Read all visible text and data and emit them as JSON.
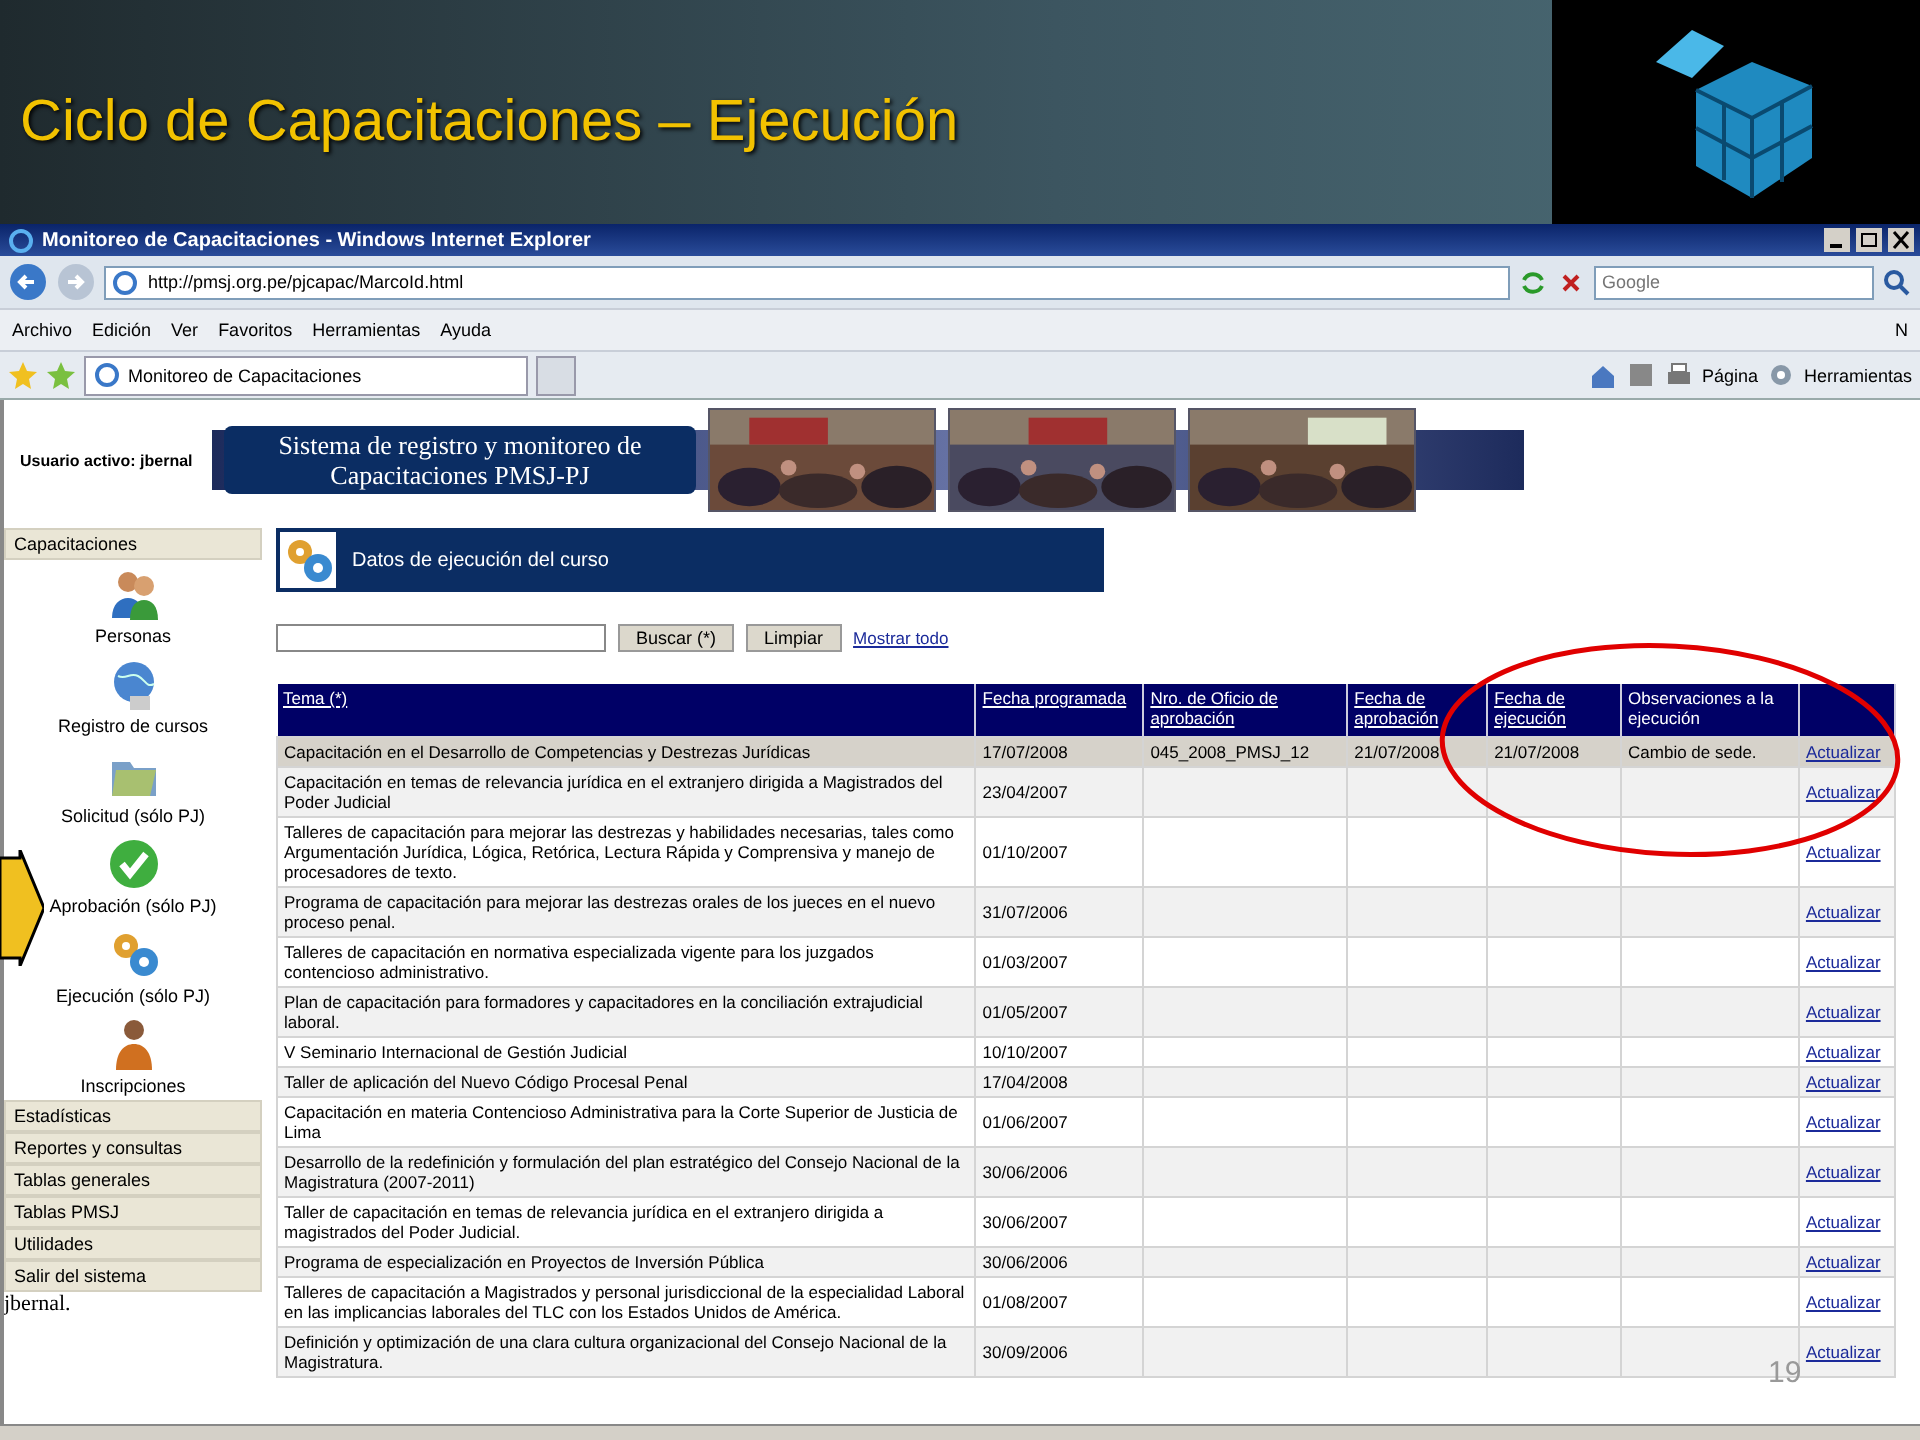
{
  "slide": {
    "title": "Ciclo de Capacitaciones – Ejecución",
    "page_number": "19"
  },
  "browser": {
    "title": "Monitoreo de Capacitaciones - Windows Internet Explorer",
    "url": "http://pmsj.org.pe/pjcapac/MarcoId.html",
    "search_placeholder": "Google",
    "menu": [
      "Archivo",
      "Edición",
      "Ver",
      "Favoritos",
      "Herramientas",
      "Ayuda"
    ],
    "menu_overflow": "N",
    "tab": "Monitoreo de Capacitaciones",
    "tools": [
      "Página",
      "Herramientas"
    ]
  },
  "header": {
    "user_label": "Usuario activo:",
    "user": "jbernal",
    "banner": "Sistema de registro y monitoreo de Capacitaciones PMSJ-PJ"
  },
  "sidebar": {
    "section": "Capacitaciones",
    "items": [
      {
        "label": "Personas",
        "kind": "people"
      },
      {
        "label": "Registro de cursos",
        "kind": "globe"
      },
      {
        "label": "Solicitud (sólo PJ)",
        "kind": "folder"
      },
      {
        "label": "Aprobación (sólo PJ)",
        "kind": "check"
      },
      {
        "label": "Ejecución (sólo PJ)",
        "kind": "gears"
      },
      {
        "label": "Inscripciones",
        "kind": "person"
      }
    ],
    "menu": [
      "Estadísticas",
      "Reportes y consultas",
      "Tablas generales",
      "Tablas PMSJ",
      "Utilidades",
      "Salir del sistema"
    ],
    "footer": "jbernal."
  },
  "panel": {
    "title": "Datos de ejecución del curso",
    "buttons": [
      "Buscar (*)",
      "Limpiar"
    ],
    "link": "Mostrar todo"
  },
  "table": {
    "columns": [
      {
        "label": "Tema (*)",
        "link": true
      },
      {
        "label": "Fecha programada",
        "link": true
      },
      {
        "label": "Nro. de Oficio de aprobación",
        "link": true
      },
      {
        "label": "Fecha de aprobación",
        "link": true
      },
      {
        "label": "Fecha de ejecución",
        "link": true
      },
      {
        "label": "Observaciones a la ejecución",
        "link": false
      }
    ],
    "rows": [
      {
        "selected": true,
        "cells": [
          "Capacitación en el Desarrollo de Competencias y Destrezas Jurídicas",
          "17/07/2008",
          "045_2008_PMSJ_12",
          "21/07/2008",
          "21/07/2008",
          "Cambio de sede."
        ],
        "action": "Actualizar"
      },
      {
        "selected": false,
        "cells": [
          "Capacitación en temas de relevancia jurídica en el extranjero dirigida a Magistrados del Poder Judicial",
          "23/04/2007"
        ],
        "action": "Actualizar"
      },
      {
        "selected": false,
        "cells": [
          "Talleres de capacitación para mejorar las destrezas y habilidades necesarias, tales como Argumentación Jurídica, Lógica, Retórica, Lectura Rápida y Comprensiva y manejo de procesadores de texto.",
          "01/10/2007"
        ],
        "action": "Actualizar"
      },
      {
        "selected": false,
        "cells": [
          "Programa de capacitación para mejorar las destrezas orales de los jueces en el nuevo proceso penal.",
          "31/07/2006"
        ],
        "action": "Actualizar"
      },
      {
        "selected": false,
        "cells": [
          "Talleres de capacitación en normativa especializada vigente para los juzgados contencioso administrativo.",
          "01/03/2007"
        ],
        "action": "Actualizar"
      },
      {
        "selected": false,
        "cells": [
          "Plan de capacitación para formadores y capacitadores en la conciliación extrajudicial laboral.",
          "01/05/2007"
        ],
        "action": "Actualizar"
      },
      {
        "selected": false,
        "cells": [
          "V Seminario Internacional de Gestión Judicial",
          "10/10/2007"
        ],
        "action": "Actualizar"
      },
      {
        "selected": false,
        "cells": [
          "Taller de aplicación del Nuevo Código Procesal Penal",
          "17/04/2008"
        ],
        "action": "Actualizar"
      },
      {
        "selected": false,
        "cells": [
          "Capacitación en materia Contencioso Administrativa para la Corte Superior de Justicia de Lima",
          "01/06/2007"
        ],
        "action": "Actualizar"
      },
      {
        "selected": false,
        "cells": [
          "Desarrollo de la redefinición y formulación del plan estratégico del Consejo Nacional de la Magistratura (2007-2011)",
          "30/06/2006"
        ],
        "action": "Actualizar"
      },
      {
        "selected": false,
        "cells": [
          "Taller de capacitación en temas de relevancia jurídica en el extranjero dirigida a magistrados del Poder Judicial.",
          "30/06/2007"
        ],
        "action": "Actualizar"
      },
      {
        "selected": false,
        "cells": [
          "Programa de especialización en Proyectos de Inversión Pública",
          "30/06/2006"
        ],
        "action": "Actualizar"
      },
      {
        "selected": false,
        "cells": [
          "Talleres de capacitación a Magistrados y personal jurisdiccional de la especialidad Laboral en las implicancias laborales del TLC con los Estados Unidos de América.",
          "01/08/2007"
        ],
        "action": "Actualizar"
      },
      {
        "selected": false,
        "cells": [
          "Definición y optimización de una clara cultura organizacional del Consejo Nacional de la Magistratura.",
          "30/09/2006"
        ],
        "action": "Actualizar"
      }
    ]
  }
}
